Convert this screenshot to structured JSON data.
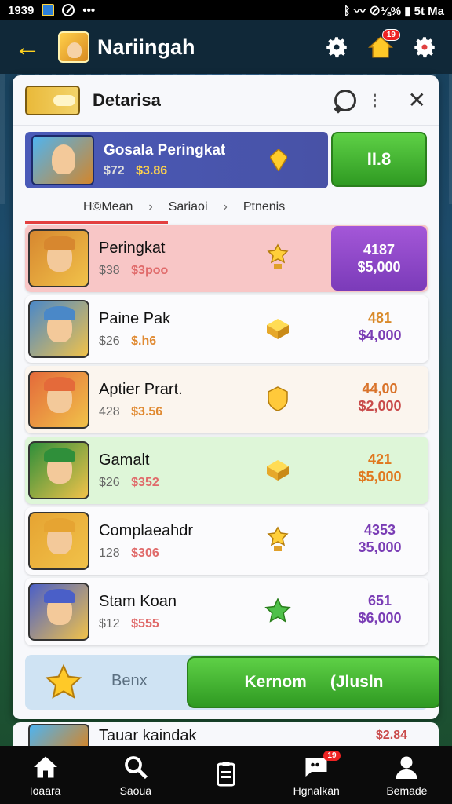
{
  "status_bar": {
    "time": "1939",
    "right_status": "ᛒ 〰 ⊘⅛% ▮ 5t Ma"
  },
  "app_bar": {
    "title": "Nariingah",
    "notification_count": "19"
  },
  "panel": {
    "title": "Detarisa",
    "featured": {
      "name": "Gosala Peringkat",
      "price_old": "$72",
      "price_new": "$3.86",
      "button_label": "II.8"
    },
    "breadcrumb": [
      "H©Mean",
      "Sariaoi",
      "Ptnenis"
    ],
    "rows": [
      {
        "name": "Peringkat",
        "price_old": "$38",
        "price_new": "$3poo",
        "right_top": "4187",
        "right_bottom": "$5,000",
        "bg": "#f8c6c6",
        "price_color": "#e06a6a",
        "right_style": "boxed",
        "gem": "trophy-gold",
        "icon_hue": "#d7872f"
      },
      {
        "name": "Paine Pak",
        "price_old": "$26",
        "price_new": "$.h6",
        "right_top": "481",
        "right_bottom": "$4,000",
        "bg": "#fbfbfd",
        "price_color": "#e08a32",
        "right_top_color": "#d98a2a",
        "right_bottom_color": "#7a3db5",
        "gem": "cube-gold",
        "icon_hue": "#4a88c8"
      },
      {
        "name": "Aptier Prart.",
        "price_old": "428",
        "price_new": "$3.56",
        "right_top": "44,00",
        "right_bottom": "$2,000",
        "bg": "#fbf5ee",
        "price_color": "#e08a32",
        "right_top_color": "#d9732a",
        "right_bottom_color": "#c94b4b",
        "gem": "shield-gold",
        "icon_hue": "#e46a3a"
      },
      {
        "name": "Gamalt",
        "price_old": "$26",
        "price_new": "$352",
        "right_top": "421",
        "right_bottom": "$5,000",
        "bg": "#def6d8",
        "price_color": "#e06a6a",
        "right_top_color": "#e0781f",
        "right_bottom_color": "#e0781f",
        "gem": "cube-gold",
        "icon_hue": "#2f8f3a"
      },
      {
        "name": "Complaeahdr",
        "price_old": "128",
        "price_new": "$306",
        "right_top": "4353",
        "right_bottom": "35,000",
        "bg": "#fbfbfd",
        "price_color": "#e06a6a",
        "right_top_color": "#7a3db5",
        "right_bottom_color": "#7a3db5",
        "gem": "trophy-gold",
        "icon_hue": "#e6a432"
      },
      {
        "name": "Stam Koan",
        "price_old": "$12",
        "price_new": "$555",
        "right_top": "651",
        "right_bottom": "$6,000",
        "bg": "#fbfbfd",
        "price_color": "#e06a6a",
        "right_top_color": "#7a3db5",
        "right_bottom_color": "#7a3db5",
        "gem": "star-green",
        "icon_hue": "#4a5fc8"
      }
    ],
    "action_bar": {
      "label": "Benx",
      "primary_left": "Kernom",
      "primary_right": "(Jlusln"
    },
    "peek": {
      "name": "Tauar kaindak",
      "right": "$2.84"
    }
  },
  "bottom_nav": [
    {
      "label": "Ioaara",
      "icon": "home-icon"
    },
    {
      "label": "Saoua",
      "icon": "search-icon"
    },
    {
      "label": "",
      "icon": "clipboard-icon"
    },
    {
      "label": "Hgnalkan",
      "icon": "chat-badge-icon",
      "badge": "19"
    },
    {
      "label": "Bemade",
      "icon": "person-icon"
    }
  ]
}
